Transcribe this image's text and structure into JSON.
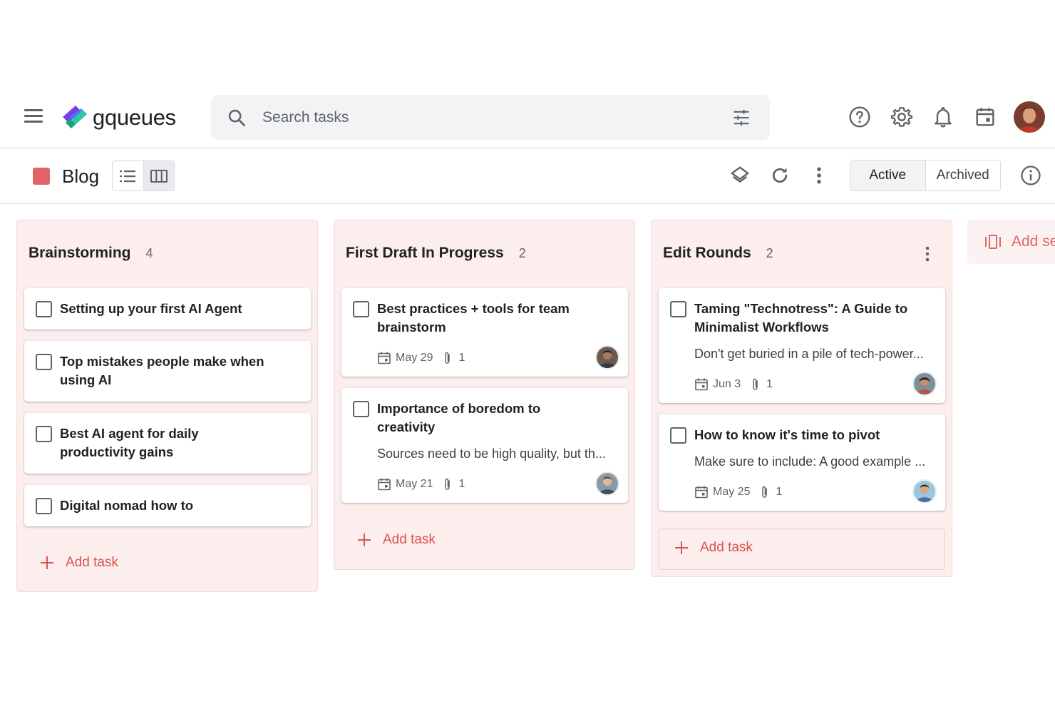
{
  "app": {
    "name": "gqueues"
  },
  "search": {
    "placeholder": "Search tasks"
  },
  "project": {
    "title": "Blog",
    "color": "#e06666"
  },
  "filter": {
    "active_label": "Active",
    "archived_label": "Archived",
    "selected": "Active"
  },
  "accent": "#d9534f",
  "columns": [
    {
      "title": "Brainstorming",
      "count": "4",
      "add_label": "Add task",
      "cards": [
        {
          "title": "Setting up your first AI Agent"
        },
        {
          "title": "Top mistakes people make when using AI"
        },
        {
          "title": "Best AI agent for daily productivity gains"
        },
        {
          "title": "Digital nomad how to"
        }
      ]
    },
    {
      "title": "First Draft In Progress",
      "count": "2",
      "add_label": "Add task",
      "cards": [
        {
          "title": "Best practices + tools for team brainstorm",
          "date": "May 29",
          "attachments": "1"
        },
        {
          "title": "Importance of boredom to creativity",
          "description": "Sources need to be high quality, but th...",
          "date": "May 21",
          "attachments": "1"
        }
      ]
    },
    {
      "title": "Edit Rounds",
      "count": "2",
      "add_label": "Add task",
      "cards": [
        {
          "title": "Taming \"Technotress\": A Guide to Minimalist Workflows",
          "description": "Don't get buried in a pile of tech-power...",
          "date": "Jun 3",
          "attachments": "1"
        },
        {
          "title": "How to know it's time to pivot",
          "description": "Make sure to include: A good example ...",
          "date": "May 25",
          "attachments": "1"
        }
      ]
    }
  ],
  "add_section": {
    "label": "Add se"
  },
  "icons": {
    "menu": "hamburger-icon",
    "search": "search-icon",
    "tune": "tune-icon",
    "help": "help-icon",
    "settings": "gear-icon",
    "notifications": "bell-icon",
    "calendar": "calendar-icon",
    "list_view": "list-view-icon",
    "board_view": "board-view-icon",
    "layers": "layers-icon",
    "refresh": "refresh-icon",
    "more": "more-vert-icon",
    "info": "info-icon"
  }
}
